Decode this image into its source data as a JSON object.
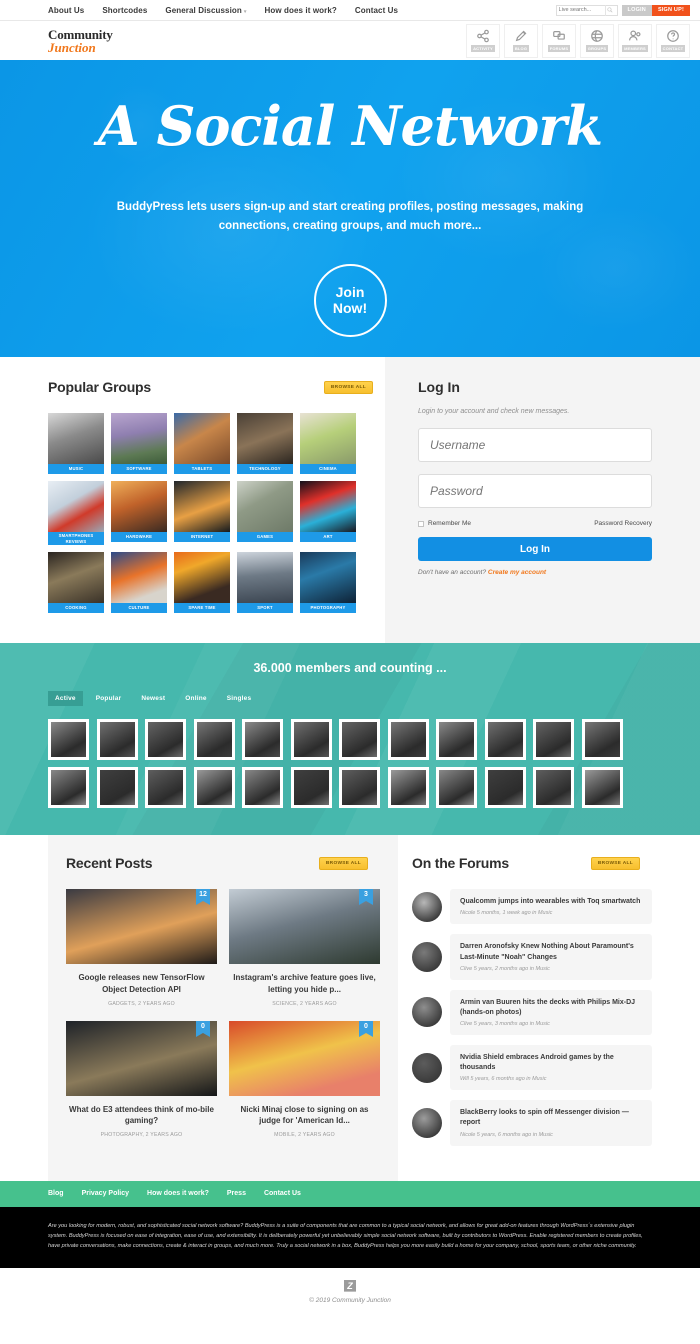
{
  "topbar": {
    "nav": [
      {
        "label": "About Us",
        "caret": false
      },
      {
        "label": "Shortcodes",
        "caret": false
      },
      {
        "label": "General Discussion",
        "caret": true
      },
      {
        "label": "How does it work?",
        "caret": false
      },
      {
        "label": "Contact Us",
        "caret": false
      }
    ],
    "search_placeholder": "Live search...",
    "login_label": "LOGIN",
    "signup_label": "SIGN UP!"
  },
  "header": {
    "logo_line1": "Community",
    "logo_line2": "Junction",
    "icons": [
      {
        "label": "ACTIVITY",
        "icon": "share-icon"
      },
      {
        "label": "BLOG",
        "icon": "pencil-icon"
      },
      {
        "label": "FORUMS",
        "icon": "chat-icon"
      },
      {
        "label": "GROUPS",
        "icon": "globe-icon"
      },
      {
        "label": "MEMBERS",
        "icon": "people-icon"
      },
      {
        "label": "CONTACT",
        "icon": "question-icon"
      }
    ]
  },
  "hero": {
    "title": "A Social Network",
    "subtitle": "BuddyPress lets users sign-up and start creating profiles, posting messages, making connections, creating groups, and much more...",
    "cta_line1": "Join",
    "cta_line2": "Now!",
    "bg_color": "#0b9ae8"
  },
  "groups": {
    "title": "Popular Groups",
    "browse_all": "BROWSE ALL",
    "accent_color": "#1e9ae8",
    "items": [
      {
        "label": "MUSIC"
      },
      {
        "label": "SOFTWARE"
      },
      {
        "label": "TABLETS"
      },
      {
        "label": "TECHNOLOGY"
      },
      {
        "label": "CINEMA"
      },
      {
        "label": "SMARTPHONES REVIEWS"
      },
      {
        "label": "HARDWARE"
      },
      {
        "label": "INTERNET"
      },
      {
        "label": "GAMES"
      },
      {
        "label": "ART"
      },
      {
        "label": "COOKING"
      },
      {
        "label": "CULTURE"
      },
      {
        "label": "SPARE TIME"
      },
      {
        "label": "SPORT"
      },
      {
        "label": "PHOTOGRAPHY"
      }
    ]
  },
  "login": {
    "title": "Log In",
    "subtitle": "Login to your account and check new messages.",
    "username_placeholder": "Username",
    "password_placeholder": "Password",
    "username_value": "",
    "password_value": "",
    "remember_label": "Remember Me",
    "recovery_label": "Password Recovery",
    "submit_label": "Log In",
    "no_account_text": "Don't have an account?",
    "create_account_label": "Create my account",
    "button_color": "#128fe3"
  },
  "members": {
    "title": "36.000 members and counting ...",
    "band_color": "#46b8ad",
    "tabs": [
      {
        "label": "Active",
        "active": true
      },
      {
        "label": "Popular",
        "active": false
      },
      {
        "label": "Newest",
        "active": false
      },
      {
        "label": "Online",
        "active": false
      },
      {
        "label": "Singles",
        "active": false
      }
    ],
    "avatar_rows": 2,
    "avatars_per_row": 12
  },
  "posts": {
    "title": "Recent Posts",
    "browse_all": "BROWSE ALL",
    "items": [
      {
        "badge": "12",
        "title": "Google releases new TensorFlow Object Detection API",
        "meta": "GADGETS, 2 YEARS AGO"
      },
      {
        "badge": "3",
        "title": "Instagram's archive feature goes live, letting you hide p...",
        "meta": "SCIENCE, 2 YEARS AGO"
      },
      {
        "badge": "0",
        "title": "What do E3 attendees think of mo-bile gaming?",
        "meta": "PHOTOGRAPHY, 2 YEARS AGO"
      },
      {
        "badge": "0",
        "title": "Nicki Minaj close to signing on as judge for 'American Id...",
        "meta": "MOBILE, 2 YEARS AGO"
      }
    ]
  },
  "forums": {
    "title": "On the Forums",
    "browse_all": "BROWSE ALL",
    "items": [
      {
        "title": "Qualcomm jumps into wearables with Toq smartwatch",
        "meta": "Nicole 5 months, 1 week ago in Music"
      },
      {
        "title": "Darren Aronofsky Knew Nothing About Paramount's Last-Minute \"Noah\" Changes",
        "meta": "Clive 5 years, 2 months ago in Music"
      },
      {
        "title": "Armin van Buuren hits the decks with Philips Mix-DJ (hands-on photos)",
        "meta": "Clive 5 years, 3 months ago in Music"
      },
      {
        "title": "Nvidia Shield embraces Android games by the thousands",
        "meta": "Will 5 years, 6 months ago in Music"
      },
      {
        "title": "BlackBerry looks to spin off Messenger division — report",
        "meta": "Nicole 5 years, 6 months ago in Music"
      }
    ]
  },
  "footer": {
    "nav": [
      "Blog",
      "Privacy Policy",
      "How does it work?",
      "Press",
      "Contact Us"
    ],
    "nav_color": "#46c18d",
    "about": "Are you looking for modern, robust, and sophisticated social network software? BuddyPress is a suite of components that are common to a typical social network, and allows for great add-on features through WordPress´s extensive plugin system. BuddyPress is focused on ease of integration, ease of use, and extensibility. It is deliberately powerful yet unbelievably simple social network software, built by contributors to WordPress. Enable registered members to create profiles, have private conversations, make connections, create & interact in groups, and much more. Truly a social network in a box, BuddyPress helps you more easily build a home for your company, school, sports team, or other niche community.",
    "copyright": "© 2019 Community Junction"
  }
}
